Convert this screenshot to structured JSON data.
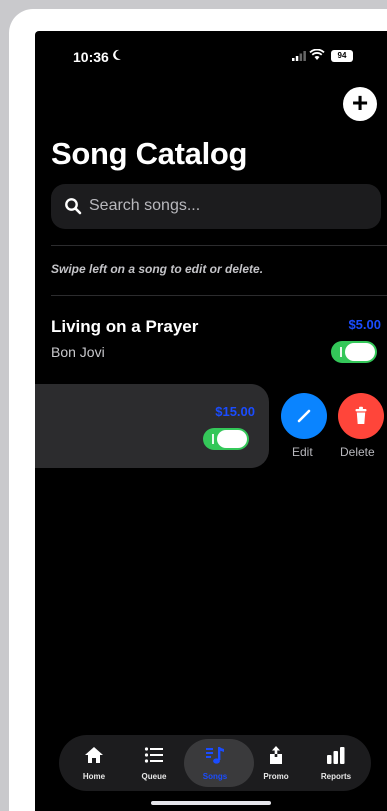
{
  "status_bar": {
    "time": "10:36",
    "battery": "94"
  },
  "header": {
    "title": "Song Catalog",
    "add_label": "+"
  },
  "search": {
    "placeholder": "Search songs...",
    "value": ""
  },
  "hint": "Swipe left on a song to edit or delete.",
  "songs": [
    {
      "title": "Living on a Prayer",
      "artist": "Bon Jovi",
      "price": "$5.00",
      "enabled": true
    },
    {
      "title": "",
      "artist": "",
      "price": "$15.00",
      "enabled": true
    }
  ],
  "swipe_actions": {
    "edit": "Edit",
    "delete": "Delete"
  },
  "colors": {
    "accent": "#1a4cff",
    "toggle_on": "#34c759",
    "edit": "#0a84ff",
    "delete": "#ff453a"
  },
  "tabs": [
    {
      "label": "Home",
      "icon": "house-icon",
      "active": false
    },
    {
      "label": "Queue",
      "icon": "list-icon",
      "active": false
    },
    {
      "label": "Songs",
      "icon": "music-note-icon",
      "active": true
    },
    {
      "label": "Promo",
      "icon": "share-icon",
      "active": false
    },
    {
      "label": "Reports",
      "icon": "bar-chart-icon",
      "active": false
    }
  ]
}
